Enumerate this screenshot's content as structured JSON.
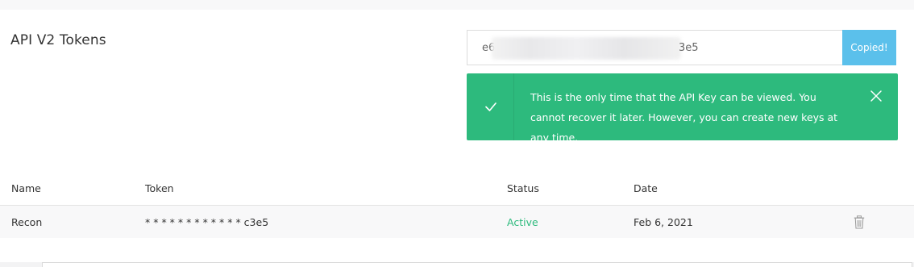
{
  "header": {
    "title": "API V2 Tokens"
  },
  "api_key": {
    "prefix": "e6",
    "suffix": "3e5",
    "copy_button_label": "Copied!"
  },
  "alert": {
    "message": "This is the only time that the API Key can be viewed. You cannot recover it later. However, you can create new keys at any time.",
    "icon": "check-icon",
    "close_icon": "close-icon"
  },
  "table": {
    "columns": [
      "Name",
      "Token",
      "Status",
      "Date"
    ],
    "rows": [
      {
        "name": "Recon",
        "token": "* * * * * * * * * * * * c3e5",
        "status": "Active",
        "date": "Feb 6, 2021"
      }
    ]
  },
  "colors": {
    "accent_blue": "#5bc0eb",
    "success_green": "#2dba7d"
  }
}
